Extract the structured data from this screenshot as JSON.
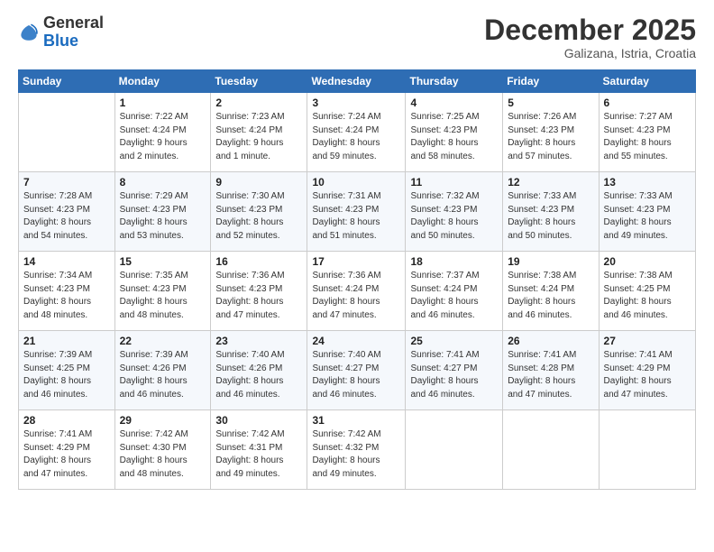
{
  "logo": {
    "general": "General",
    "blue": "Blue"
  },
  "header": {
    "month": "December 2025",
    "location": "Galizana, Istria, Croatia"
  },
  "days_of_week": [
    "Sunday",
    "Monday",
    "Tuesday",
    "Wednesday",
    "Thursday",
    "Friday",
    "Saturday"
  ],
  "weeks": [
    [
      {
        "day": "",
        "info": ""
      },
      {
        "day": "1",
        "info": "Sunrise: 7:22 AM\nSunset: 4:24 PM\nDaylight: 9 hours\nand 2 minutes."
      },
      {
        "day": "2",
        "info": "Sunrise: 7:23 AM\nSunset: 4:24 PM\nDaylight: 9 hours\nand 1 minute."
      },
      {
        "day": "3",
        "info": "Sunrise: 7:24 AM\nSunset: 4:24 PM\nDaylight: 8 hours\nand 59 minutes."
      },
      {
        "day": "4",
        "info": "Sunrise: 7:25 AM\nSunset: 4:23 PM\nDaylight: 8 hours\nand 58 minutes."
      },
      {
        "day": "5",
        "info": "Sunrise: 7:26 AM\nSunset: 4:23 PM\nDaylight: 8 hours\nand 57 minutes."
      },
      {
        "day": "6",
        "info": "Sunrise: 7:27 AM\nSunset: 4:23 PM\nDaylight: 8 hours\nand 55 minutes."
      }
    ],
    [
      {
        "day": "7",
        "info": "Sunrise: 7:28 AM\nSunset: 4:23 PM\nDaylight: 8 hours\nand 54 minutes."
      },
      {
        "day": "8",
        "info": "Sunrise: 7:29 AM\nSunset: 4:23 PM\nDaylight: 8 hours\nand 53 minutes."
      },
      {
        "day": "9",
        "info": "Sunrise: 7:30 AM\nSunset: 4:23 PM\nDaylight: 8 hours\nand 52 minutes."
      },
      {
        "day": "10",
        "info": "Sunrise: 7:31 AM\nSunset: 4:23 PM\nDaylight: 8 hours\nand 51 minutes."
      },
      {
        "day": "11",
        "info": "Sunrise: 7:32 AM\nSunset: 4:23 PM\nDaylight: 8 hours\nand 50 minutes."
      },
      {
        "day": "12",
        "info": "Sunrise: 7:33 AM\nSunset: 4:23 PM\nDaylight: 8 hours\nand 50 minutes."
      },
      {
        "day": "13",
        "info": "Sunrise: 7:33 AM\nSunset: 4:23 PM\nDaylight: 8 hours\nand 49 minutes."
      }
    ],
    [
      {
        "day": "14",
        "info": "Sunrise: 7:34 AM\nSunset: 4:23 PM\nDaylight: 8 hours\nand 48 minutes."
      },
      {
        "day": "15",
        "info": "Sunrise: 7:35 AM\nSunset: 4:23 PM\nDaylight: 8 hours\nand 48 minutes."
      },
      {
        "day": "16",
        "info": "Sunrise: 7:36 AM\nSunset: 4:23 PM\nDaylight: 8 hours\nand 47 minutes."
      },
      {
        "day": "17",
        "info": "Sunrise: 7:36 AM\nSunset: 4:24 PM\nDaylight: 8 hours\nand 47 minutes."
      },
      {
        "day": "18",
        "info": "Sunrise: 7:37 AM\nSunset: 4:24 PM\nDaylight: 8 hours\nand 46 minutes."
      },
      {
        "day": "19",
        "info": "Sunrise: 7:38 AM\nSunset: 4:24 PM\nDaylight: 8 hours\nand 46 minutes."
      },
      {
        "day": "20",
        "info": "Sunrise: 7:38 AM\nSunset: 4:25 PM\nDaylight: 8 hours\nand 46 minutes."
      }
    ],
    [
      {
        "day": "21",
        "info": "Sunrise: 7:39 AM\nSunset: 4:25 PM\nDaylight: 8 hours\nand 46 minutes."
      },
      {
        "day": "22",
        "info": "Sunrise: 7:39 AM\nSunset: 4:26 PM\nDaylight: 8 hours\nand 46 minutes."
      },
      {
        "day": "23",
        "info": "Sunrise: 7:40 AM\nSunset: 4:26 PM\nDaylight: 8 hours\nand 46 minutes."
      },
      {
        "day": "24",
        "info": "Sunrise: 7:40 AM\nSunset: 4:27 PM\nDaylight: 8 hours\nand 46 minutes."
      },
      {
        "day": "25",
        "info": "Sunrise: 7:41 AM\nSunset: 4:27 PM\nDaylight: 8 hours\nand 46 minutes."
      },
      {
        "day": "26",
        "info": "Sunrise: 7:41 AM\nSunset: 4:28 PM\nDaylight: 8 hours\nand 47 minutes."
      },
      {
        "day": "27",
        "info": "Sunrise: 7:41 AM\nSunset: 4:29 PM\nDaylight: 8 hours\nand 47 minutes."
      }
    ],
    [
      {
        "day": "28",
        "info": "Sunrise: 7:41 AM\nSunset: 4:29 PM\nDaylight: 8 hours\nand 47 minutes."
      },
      {
        "day": "29",
        "info": "Sunrise: 7:42 AM\nSunset: 4:30 PM\nDaylight: 8 hours\nand 48 minutes."
      },
      {
        "day": "30",
        "info": "Sunrise: 7:42 AM\nSunset: 4:31 PM\nDaylight: 8 hours\nand 49 minutes."
      },
      {
        "day": "31",
        "info": "Sunrise: 7:42 AM\nSunset: 4:32 PM\nDaylight: 8 hours\nand 49 minutes."
      },
      {
        "day": "",
        "info": ""
      },
      {
        "day": "",
        "info": ""
      },
      {
        "day": "",
        "info": ""
      }
    ]
  ]
}
